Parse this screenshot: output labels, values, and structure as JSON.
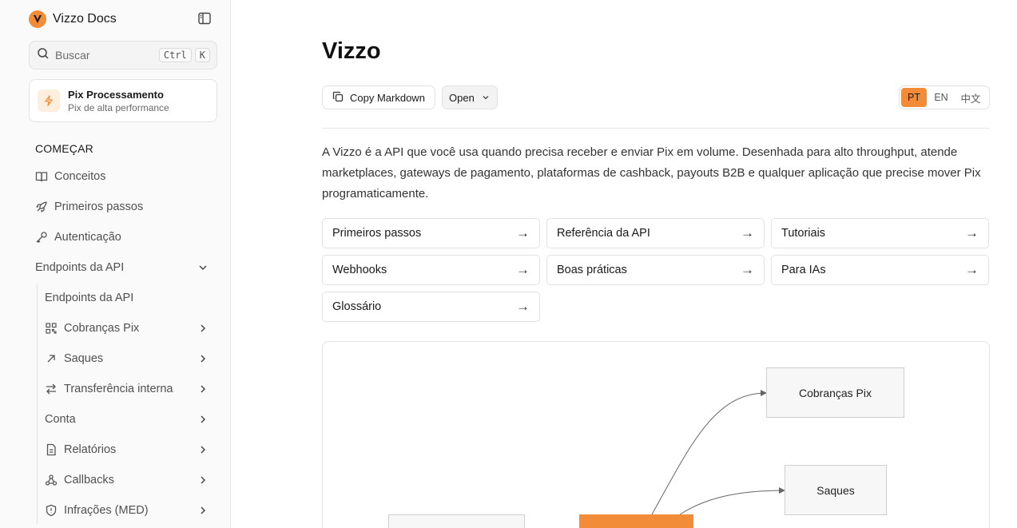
{
  "sidebar": {
    "brand": "Vizzo Docs",
    "search": {
      "placeholder": "Buscar",
      "kbd_ctrl": "Ctrl",
      "kbd_k": "K"
    },
    "product": {
      "title": "Pix Processamento",
      "subtitle": "Pix de alta performance"
    },
    "section_title": "COMEÇAR",
    "items": [
      {
        "label": "Conceitos",
        "icon": "book-icon"
      },
      {
        "label": "Primeiros passos",
        "icon": "rocket-icon"
      },
      {
        "label": "Autenticação",
        "icon": "key-icon"
      },
      {
        "label": "Endpoints da API",
        "icon": "",
        "expanded": true
      }
    ],
    "subitems": [
      {
        "label": "Endpoints da API",
        "icon": ""
      },
      {
        "label": "Cobranças Pix",
        "icon": "qr-code-icon"
      },
      {
        "label": "Saques",
        "icon": "arrow-up-right-icon"
      },
      {
        "label": "Transferência interna",
        "icon": "transfer-icon"
      },
      {
        "label": "Conta",
        "icon": ""
      },
      {
        "label": "Relatórios",
        "icon": "document-icon"
      },
      {
        "label": "Callbacks",
        "icon": "webhook-icon"
      },
      {
        "label": "Infrações (MED)",
        "icon": "shield-icon"
      }
    ]
  },
  "main": {
    "title": "Vizzo",
    "copy_markdown": "Copy Markdown",
    "open": "Open",
    "languages": [
      "PT",
      "EN",
      "中文"
    ],
    "active_language": "PT",
    "intro": "A Vizzo é a API que você usa quando precisa receber e enviar Pix em volume. Desenhada para alto throughput, atende marketplaces, gateways de pagamento, plataformas de cashback, payouts B2B e qualquer aplicação que precise mover Pix programaticamente.",
    "cards": [
      {
        "label": "Primeiros passos",
        "arrow": "→"
      },
      {
        "label": "Referência da API",
        "arrow": "→"
      },
      {
        "label": "Tutoriais",
        "arrow": "→"
      },
      {
        "label": "Webhooks",
        "arrow": "→"
      },
      {
        "label": "Boas práticas",
        "arrow": "→"
      },
      {
        "label": "Para IAs",
        "arrow": "→"
      },
      {
        "label": "Glossário",
        "arrow": "→"
      }
    ],
    "diagram": {
      "nodes": [
        "Cobranças Pix",
        "Saques"
      ]
    }
  },
  "colors": {
    "accent": "#f28c38",
    "border": "#e1e1e1",
    "sidebar_bg": "#fafafa"
  }
}
